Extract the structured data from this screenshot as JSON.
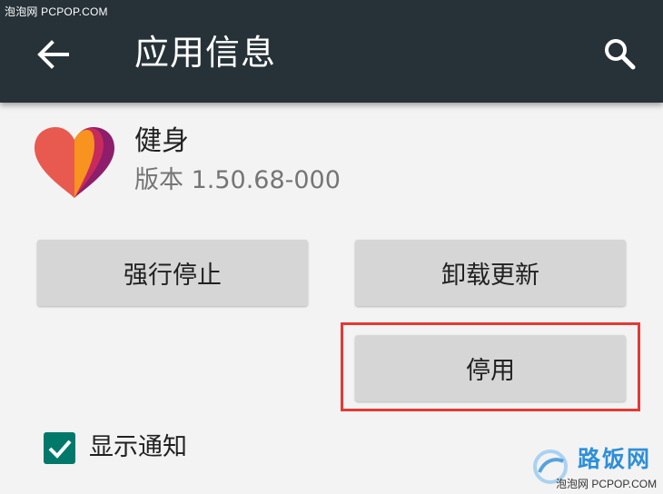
{
  "watermark": {
    "top": "泡泡网 PCPOP.COM",
    "brand": "路饭网",
    "bottom": "泡泡网 PCPOP.COM"
  },
  "appbar": {
    "title": "应用信息",
    "back_icon": "arrow-back-icon",
    "search_icon": "search-icon",
    "background": "#263238"
  },
  "app": {
    "name": "健身",
    "version": "版本 1.50.68-000",
    "icon": "heart-icon"
  },
  "buttons": {
    "force_stop": "强行停止",
    "uninstall_updates": "卸载更新",
    "disable": "停用"
  },
  "notifications": {
    "label": "显示通知",
    "checked": true,
    "accent": "#00796b"
  },
  "highlight_color": "#e53935"
}
